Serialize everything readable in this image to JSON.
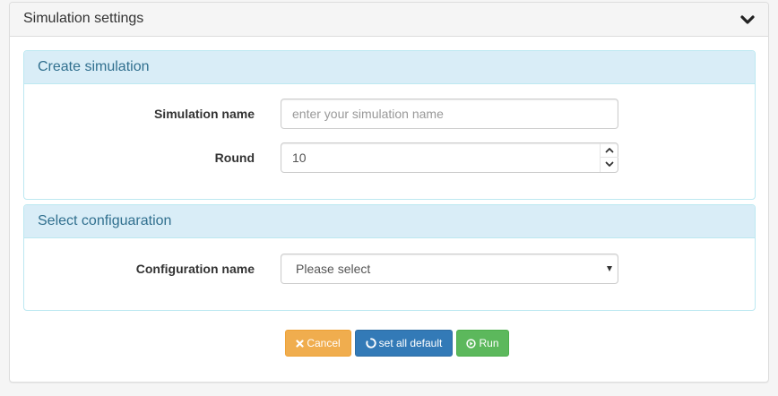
{
  "header": {
    "title": "Simulation settings",
    "toggle_icon": "chevron-down-icon"
  },
  "create_panel": {
    "title": "Create simulation",
    "name_label": "Simulation name",
    "name_value": "",
    "name_placeholder": "enter your simulation name",
    "round_label": "Round",
    "round_value": "10"
  },
  "config_panel": {
    "title": "Select configuaration",
    "config_label": "Configuration name",
    "config_selected": "Please select"
  },
  "actions": {
    "cancel_label": "Cancel",
    "cancel_icon": "close-icon",
    "default_label": "set all default",
    "default_icon": "refresh-icon",
    "run_label": "Run",
    "run_icon": "play-circle-icon"
  },
  "colors": {
    "info_heading_bg": "#d9edf7",
    "info_border": "#bce8f1",
    "info_text": "#31708f",
    "warning": "#f0ad4e",
    "primary": "#337ab7",
    "success": "#5cb85c"
  }
}
